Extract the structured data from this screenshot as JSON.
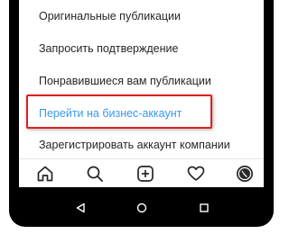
{
  "menu": {
    "items": [
      {
        "label": "Оригинальные публикации"
      },
      {
        "label": "Запросить подтверждение"
      },
      {
        "label": "Понравившиеся вам публикации"
      },
      {
        "label": "Перейти на бизнес-аккаунт"
      },
      {
        "label": "Зарегистрировать аккаунт компании"
      }
    ]
  },
  "bottom_nav": {
    "icons": [
      "home-icon",
      "search-icon",
      "add-post-icon",
      "heart-icon",
      "profile-avatar"
    ]
  },
  "system_nav": {
    "icons": [
      "back-icon",
      "home-icon",
      "recent-apps-icon"
    ]
  },
  "colors": {
    "link": "#3897f0",
    "text": "#262626",
    "highlight": "#e0201d",
    "frame": "#000000"
  }
}
